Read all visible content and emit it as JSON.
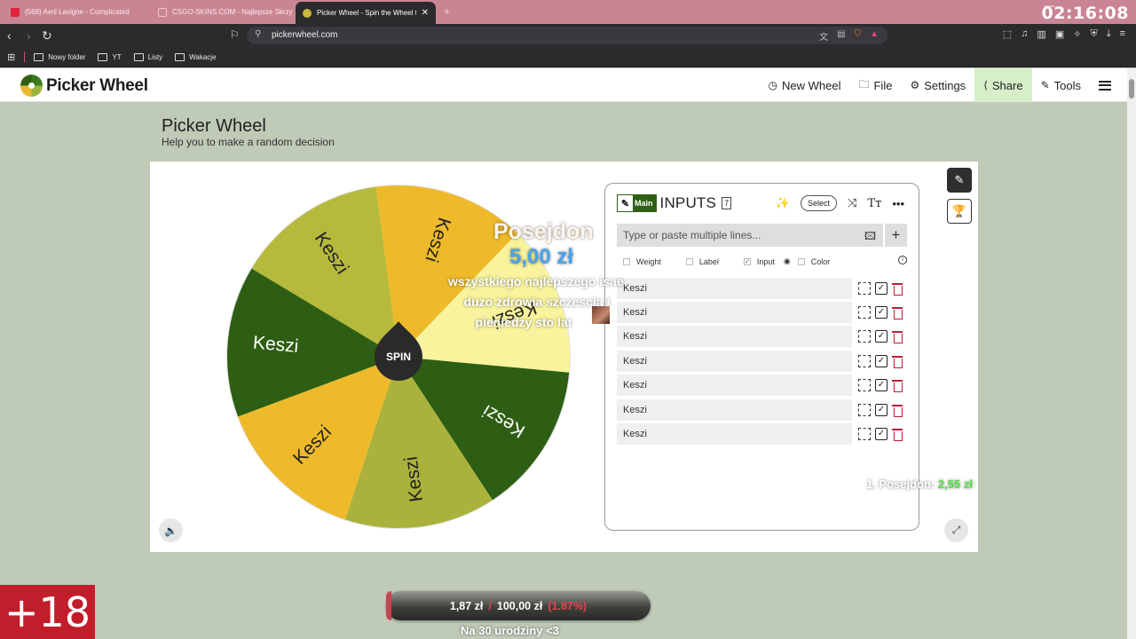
{
  "browser": {
    "tabs": [
      {
        "title": "(568) Avril Lavigne - Complicated",
        "favicon_color": "#e3223b"
      },
      {
        "title": "CSGO-SKINS.COM - Najlepsze Skrzynki",
        "favicon_color": "#c46f82"
      },
      {
        "title": "Picker Wheel - Spin the Wheel to",
        "favicon_color": "#c9b63a",
        "active": true
      }
    ],
    "close_glyph": "✕",
    "new_tab_glyph": "+",
    "url": "pickerwheel.com",
    "clock": "02:16:08",
    "bookmarks": [
      "Nowy folder",
      "YT",
      "Listy",
      "Wakacje"
    ]
  },
  "site": {
    "logo_text": "Picker Wheel",
    "nav": [
      {
        "label": "New Wheel",
        "icon": "clock-icon",
        "glyph": "◷"
      },
      {
        "label": "File",
        "icon": "folder-icon",
        "glyph": "🗀"
      },
      {
        "label": "Settings",
        "icon": "gear-icon",
        "glyph": "⚙"
      },
      {
        "label": "Share",
        "icon": "share-icon",
        "glyph": "⟨"
      },
      {
        "label": "Tools",
        "icon": "wrench-icon",
        "glyph": "✎"
      }
    ]
  },
  "page": {
    "title": "Picker Wheel",
    "subtitle": "Help you to make a random decision"
  },
  "wheel": {
    "spin_label": "SPIN",
    "segments": [
      {
        "label": "Keszi",
        "color": "#b5ba3c"
      },
      {
        "label": "Keszi",
        "color": "#eeba2a"
      },
      {
        "label": "Keszi",
        "color": "#f8f39c"
      },
      {
        "label": "Keszi",
        "color": "#2d5e13"
      },
      {
        "label": "Keszi",
        "color": "#aab23c"
      },
      {
        "label": "Keszi",
        "color": "#eeba2a"
      },
      {
        "label": "Keszi",
        "color": "#2d5e13"
      }
    ]
  },
  "inputs_panel": {
    "main_label": "Main",
    "title": "INPUTS",
    "count": "7",
    "select_label": "Select",
    "placeholder": "Type or paste multiple lines...",
    "options": [
      {
        "label": "Weight",
        "checked": false
      },
      {
        "label": "Label",
        "checked": false
      },
      {
        "label": "Input",
        "checked": true
      },
      {
        "label": "Color",
        "checked": false
      }
    ],
    "checkmark": "✓",
    "items": [
      "Keszi",
      "Keszi",
      "Keszi",
      "Keszi",
      "Keszi",
      "Keszi",
      "Keszi"
    ]
  },
  "overlay": {
    "donor_name": "Posejdon",
    "donation_amount": "5,00 zł",
    "message_lines": [
      "wszystkiego najlepszego isae",
      "duzo zdrowia szczescia i",
      "pieniedzy sto lat"
    ],
    "top_donor": {
      "rank_name": "1. Posejdon:",
      "amount": "2,55 zł"
    },
    "goal": {
      "current": "1,87 zł",
      "separator": "/",
      "target": "100,00 zł",
      "percent": "(1.87%)",
      "progress": 0.0187
    },
    "goal_caption": "Na 30 urodziny <3",
    "age_badge": "+18"
  }
}
